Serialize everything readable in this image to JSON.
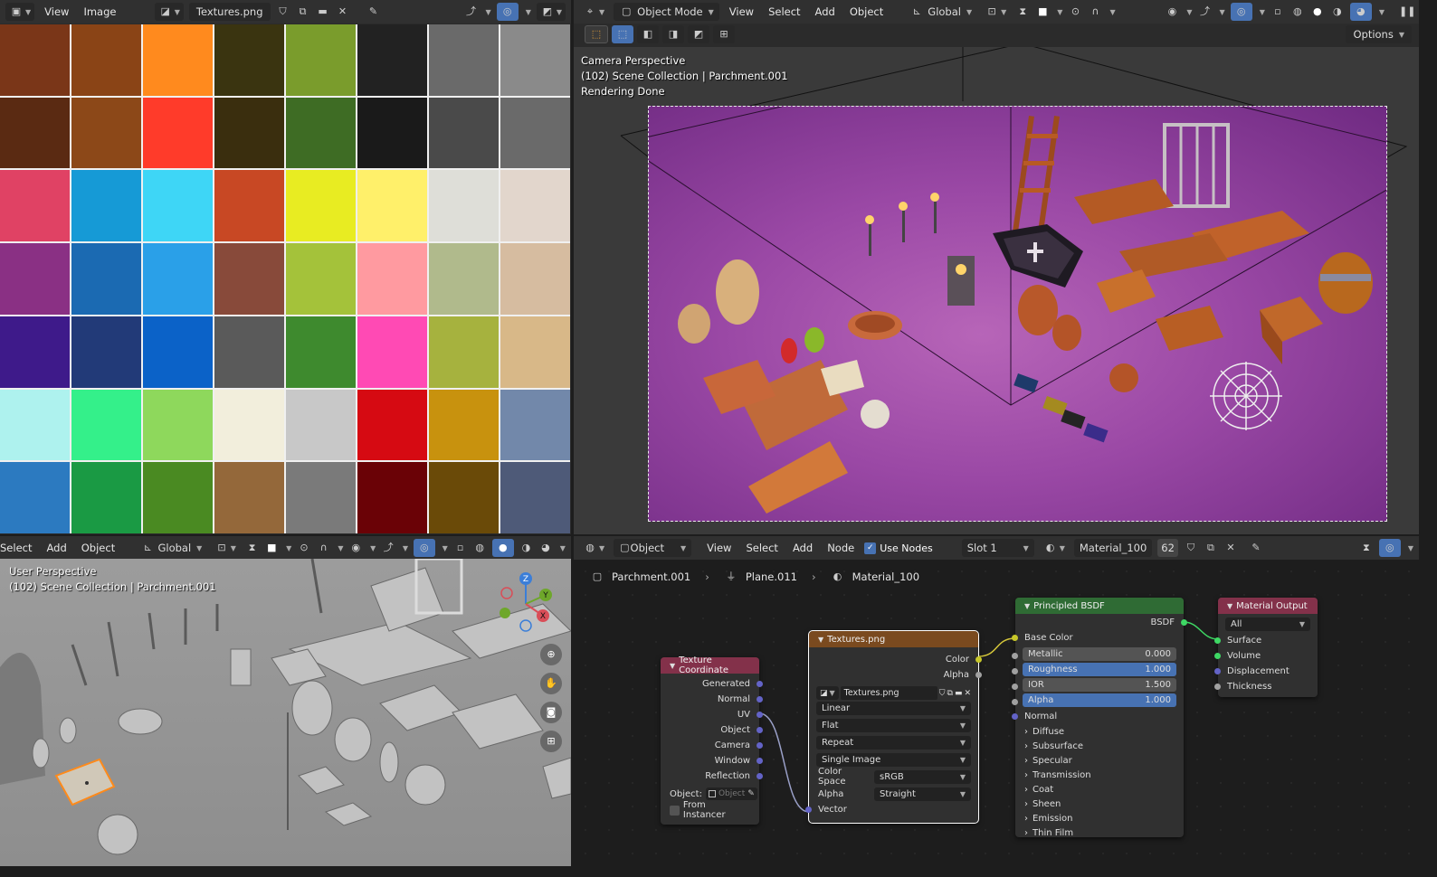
{
  "image_editor": {
    "menus": [
      "View",
      "Image"
    ],
    "image_name": "Textures.png",
    "palette": [
      "#7a3618",
      "#8a4416",
      "#ff8a1e",
      "#3a3410",
      "#7a9c2c",
      "#222222",
      "#6a6a6a",
      "#8a8a8a",
      "#5a2a12",
      "#8c4818",
      "#ff3b2a",
      "#3a2e0e",
      "#3e6c24",
      "#1a1a1a",
      "#4a4a4a",
      "#6a6a6a",
      "#e04264",
      "#169ad6",
      "#3ed6f6",
      "#c84824",
      "#e8ec22",
      "#fff06a",
      "#deded8",
      "#e2d6cc",
      "#8a3084",
      "#1b6ab2",
      "#2aa0e8",
      "#884a3a",
      "#a4c23a",
      "#ff9aa0",
      "#b0ba8c",
      "#d6bca0",
      "#3e1a8a",
      "#223a78",
      "#0b62c8",
      "#5a5a5a",
      "#3e8a2e",
      "#ff4ab4",
      "#a6b23e",
      "#d8b888",
      "#aef2ee",
      "#34f08a",
      "#8ed85c",
      "#f2eedc",
      "#c8c8c8",
      "#d60a12",
      "#c8920e",
      "#7288aa",
      "#2c7ac0",
      "#1a9a44",
      "#4a8a22",
      "#94683a",
      "#7a7a7a",
      "#6a0206",
      "#6a4a08",
      "#4e5a78"
    ]
  },
  "render_view": {
    "mode": "Object Mode",
    "menus": [
      "View",
      "Select",
      "Add",
      "Object"
    ],
    "orientation": "Global",
    "options_label": "Options",
    "info_lines": [
      "Camera Perspective",
      "(102) Scene Collection | Parchment.001",
      "Rendering Done"
    ]
  },
  "solid_view": {
    "menus": [
      "Select",
      "Add",
      "Object"
    ],
    "orientation": "Global",
    "info_lines": [
      "User Perspective",
      "(102) Scene Collection | Parchment.001"
    ],
    "gizmo": {
      "x": "X",
      "y": "Y",
      "z": "Z"
    }
  },
  "node_editor": {
    "editor_type": "Object",
    "menus": [
      "View",
      "Select",
      "Add",
      "Node"
    ],
    "use_nodes_label": "Use Nodes",
    "slot": "Slot 1",
    "material_name": "Material_100",
    "user_count": "62",
    "breadcrumb": [
      "Parchment.001",
      "Plane.011",
      "Material_100"
    ],
    "texcoord": {
      "title": "Texture Coordinate",
      "outputs": [
        "Generated",
        "Normal",
        "UV",
        "Object",
        "Camera",
        "Window",
        "Reflection"
      ],
      "object_label": "Object:",
      "object_placeholder": "Object",
      "from_instancer": "From Instancer"
    },
    "image_tex": {
      "title": "Textures.png",
      "outputs": [
        "Color",
        "Alpha"
      ],
      "image": "Textures.png",
      "interpolation": "Linear",
      "projection": "Flat",
      "extension": "Repeat",
      "source": "Single Image",
      "color_space_label": "Color Space",
      "color_space": "sRGB",
      "alpha_label": "Alpha",
      "alpha": "Straight",
      "input": "Vector"
    },
    "bsdf": {
      "title": "Principled BSDF",
      "output": "BSDF",
      "base_color": "Base Color",
      "fields": [
        {
          "label": "Metallic",
          "value": "0.000",
          "style": "gray"
        },
        {
          "label": "Roughness",
          "value": "1.000",
          "style": "blue"
        },
        {
          "label": "IOR",
          "value": "1.500",
          "style": "gray"
        },
        {
          "label": "Alpha",
          "value": "1.000",
          "style": "blue"
        }
      ],
      "normal": "Normal",
      "panels": [
        "Diffuse",
        "Subsurface",
        "Specular",
        "Transmission",
        "Coat",
        "Sheen",
        "Emission",
        "Thin Film"
      ]
    },
    "output": {
      "title": "Material Output",
      "target": "All",
      "inputs": [
        "Surface",
        "Volume",
        "Displacement",
        "Thickness"
      ]
    }
  }
}
